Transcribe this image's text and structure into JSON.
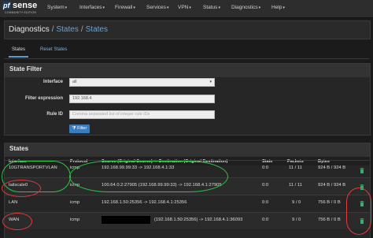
{
  "brand": {
    "logo_pf": "pf",
    "logo_sense": "sense",
    "edition": "COMMUNITY EDITION"
  },
  "nav": [
    "System",
    "Interfaces",
    "Firewall",
    "Services",
    "VPN",
    "Status",
    "Diagnostics",
    "Help"
  ],
  "breadcrumb": [
    "Diagnostics",
    "States",
    "States"
  ],
  "tabs": [
    "States",
    "Reset States"
  ],
  "filter_panel": {
    "title": "State Filter",
    "interface_label": "Interface",
    "interface_value": "all",
    "filter_expression_label": "Filter expression",
    "filter_expression_value": "192.168.4",
    "rule_id_label": "Rule ID",
    "rule_id_placeholder": "Comma separated list of integer rule IDs",
    "filter_button": "Filter"
  },
  "states_panel": {
    "title": "States",
    "columns": [
      "Interface",
      "Protocol",
      "Source (Original Source) -> Destination (Original Destination)",
      "State",
      "Packets",
      "Bytes"
    ],
    "rows": [
      {
        "interface": "10GTRANSPORTVLAN",
        "protocol": "icmp",
        "source_dest": "192.168.99.99:33 -> 192.168.4.1:33",
        "state": "0:0",
        "packets": "11 / 11",
        "bytes": "924 B / 924 B"
      },
      {
        "interface": "tailscale0",
        "protocol": "icmp",
        "source_dest": "100.64.0.2:27905 (192.168.99.99:33) -> 192.168.4.1:27905",
        "state": "0:0",
        "packets": "11 / 11",
        "bytes": "924 B / 924 B"
      },
      {
        "interface": "LAN",
        "protocol": "icmp",
        "source_dest": "192.168.1.50:25356 -> 192.168.4.1:25356",
        "state": "0:0",
        "packets": "9 / 0",
        "bytes": "756 B / 0 B"
      },
      {
        "interface": "WAN",
        "protocol": "icmp",
        "source_dest": "(192.168.1.50:25356) -> 192.168.4.1:36093",
        "state": "0:0",
        "packets": "9 / 0",
        "bytes": "756 B / 0 B"
      }
    ]
  },
  "colors": {
    "accent": "#5a9bd4",
    "link": "#6aa1d8",
    "button": "#3a7cc0",
    "trash": "#2db36f",
    "annotation_green": "#2ec44a",
    "annotation_red": "#e83a3a"
  },
  "icons": {
    "trash": "trash-icon",
    "filter": "filter-icon"
  }
}
